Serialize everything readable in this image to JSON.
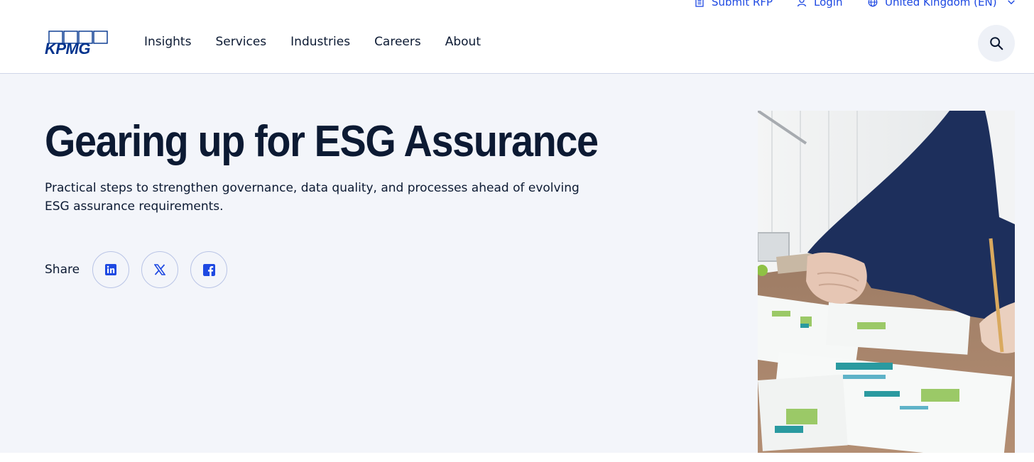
{
  "utility": {
    "submit_rfp": "Submit RFP",
    "login": "Login",
    "region": "United Kingdom (EN)"
  },
  "header": {
    "logo_text": "KPMG",
    "nav": [
      "Insights",
      "Services",
      "Industries",
      "Careers",
      "About"
    ]
  },
  "hero": {
    "title": "Gearing up for ESG Assurance",
    "subtitle": "Practical steps to strengthen governance, data quality, and processes ahead of evolving ESG assurance requirements.",
    "share_label": "Share",
    "share_icons": [
      "linkedin-icon",
      "x-icon",
      "facebook-icon"
    ]
  },
  "colors": {
    "brand_blue": "#1e49e2",
    "kpmg_navy": "#00338d",
    "text_dark": "#0c1a33",
    "hero_bg": "#f3f5fa"
  }
}
